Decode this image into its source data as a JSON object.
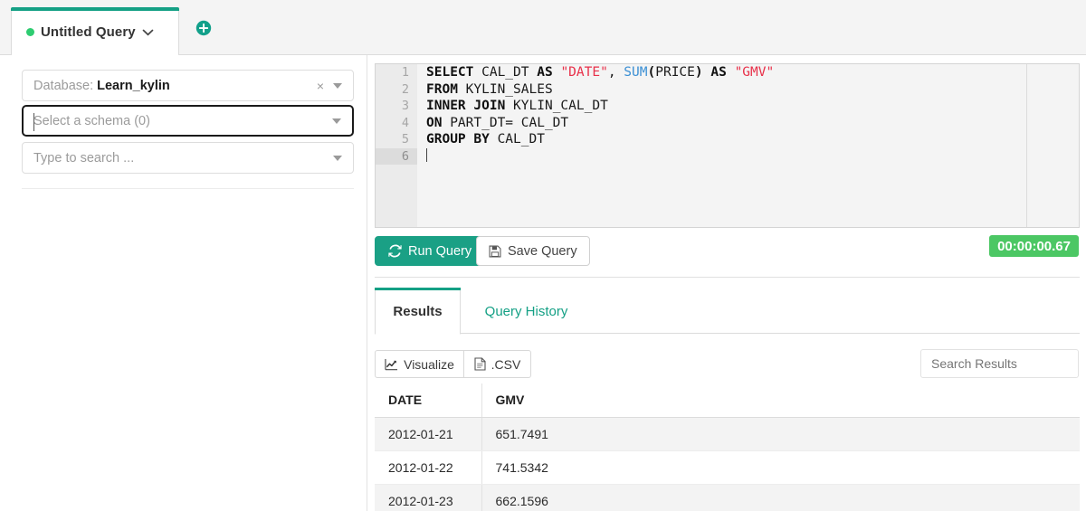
{
  "tabbar": {
    "tabs": [
      {
        "label": "Untitled Query",
        "status_dot_color": "#2ecc71",
        "caret": "⌄"
      }
    ],
    "add_tab_icon": "plus-circle-icon"
  },
  "sidebar": {
    "database_select": {
      "prefix": "Database: ",
      "value": "Learn_kylin",
      "clear_glyph": "×"
    },
    "schema_select": {
      "placeholder": "Select a schema (0)",
      "value": "",
      "focused": true
    },
    "search_select": {
      "placeholder": "Type to search ...",
      "value": ""
    }
  },
  "editor": {
    "line_numbers": [
      "1",
      "2",
      "3",
      "4",
      "5",
      "6"
    ],
    "active_line": 6,
    "lines": [
      "SELECT CAL_DT AS \"DATE\", SUM(PRICE) AS \"GMV\"",
      "FROM KYLIN_SALES",
      "INNER JOIN KYLIN_CAL_DT",
      "ON PART_DT= CAL_DT",
      "GROUP BY CAL_DT",
      ""
    ]
  },
  "actions": {
    "run_label": "Run Query",
    "run_icon": "refresh-icon",
    "save_label": "Save Query",
    "save_icon": "floppy-disk-icon",
    "timer": "00:00:00.67",
    "timer_color": "#4cc764",
    "accent_color": "#1aa085"
  },
  "result_tabs": [
    {
      "label": "Results",
      "active": true
    },
    {
      "label": "Query History",
      "active": false
    }
  ],
  "toolbar": {
    "visualize_label": "Visualize",
    "visualize_icon": "line-chart-icon",
    "csv_label": ".CSV",
    "csv_icon": "file-icon",
    "search_placeholder": "Search Results"
  },
  "results_table": {
    "columns": [
      "DATE",
      "GMV"
    ],
    "rows": [
      [
        "2012-01-21",
        "651.7491"
      ],
      [
        "2012-01-22",
        "741.5342"
      ],
      [
        "2012-01-23",
        "662.1596"
      ]
    ]
  }
}
